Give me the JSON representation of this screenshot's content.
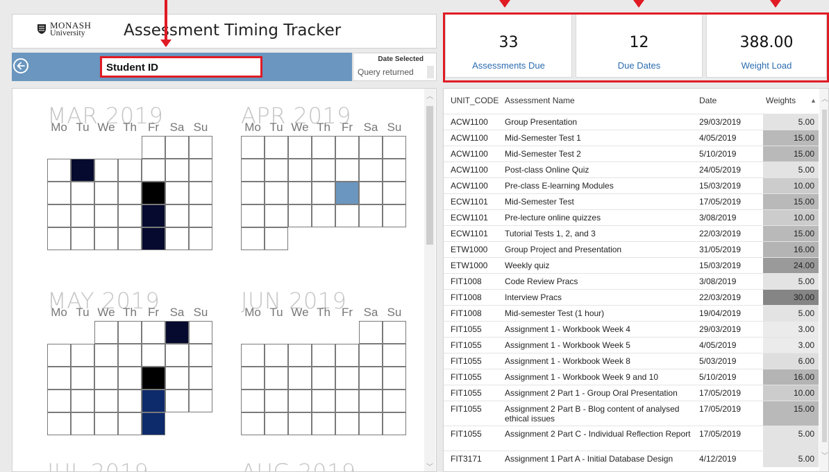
{
  "header": {
    "logo_line1": "MONASH",
    "logo_line2": "University",
    "title": "Assessment Timing Tracker"
  },
  "filter_bar": {
    "student_id_label": "Student ID",
    "date_selected_label": "Date Selected",
    "date_selected_value": "Query returned"
  },
  "kpis": [
    {
      "value": "33",
      "label": "Assessments Due"
    },
    {
      "value": "12",
      "label": "Due Dates"
    },
    {
      "value": "388.00",
      "label": "Weight Load"
    }
  ],
  "colors": {
    "accent_blue": "#6a96bf",
    "highlight_red": "#e01b24",
    "dark_navy": "#050a2e",
    "black": "#000000",
    "mid_blue": "#0d2a6b",
    "light_blue": "#6a96bf",
    "link_blue": "#2b6cb0"
  },
  "calendar": {
    "weekdays": [
      "Mo",
      "Tu",
      "We",
      "Th",
      "Fr",
      "Sa",
      "Su"
    ],
    "months": [
      {
        "title": "MAR 2019",
        "weeks": [
          [
            0,
            0,
            0,
            0,
            0,
            0,
            0
          ],
          [
            0,
            2,
            0,
            0,
            0,
            0,
            0
          ],
          [
            0,
            0,
            0,
            0,
            1,
            0,
            0
          ],
          [
            0,
            0,
            0,
            0,
            2,
            0,
            0
          ],
          [
            0,
            0,
            0,
            0,
            2,
            0,
            0
          ]
        ],
        "first_week_start": 4,
        "last_week_end": 6
      },
      {
        "title": "APR 2019",
        "weeks": [
          [
            0,
            0,
            0,
            0,
            0,
            0,
            0
          ],
          [
            0,
            0,
            0,
            0,
            0,
            0,
            0
          ],
          [
            0,
            0,
            0,
            0,
            4,
            0,
            0
          ],
          [
            0,
            0,
            0,
            0,
            0,
            0,
            0
          ],
          [
            0,
            0,
            0,
            0,
            0,
            0,
            0
          ]
        ],
        "first_week_start": 0,
        "last_week_end": 1
      },
      {
        "title": "MAY 2019",
        "weeks": [
          [
            0,
            0,
            0,
            0,
            0,
            2,
            0
          ],
          [
            0,
            0,
            0,
            0,
            0,
            0,
            0
          ],
          [
            0,
            0,
            0,
            0,
            1,
            0,
            0
          ],
          [
            0,
            0,
            0,
            0,
            3,
            0,
            0
          ],
          [
            0,
            0,
            0,
            0,
            3,
            0,
            0
          ]
        ],
        "first_week_start": 2,
        "last_week_end": 4
      },
      {
        "title": "JUN 2019",
        "weeks": [
          [
            0,
            0,
            0,
            0,
            0,
            0,
            0
          ],
          [
            0,
            0,
            0,
            0,
            0,
            0,
            0
          ],
          [
            0,
            0,
            0,
            0,
            0,
            0,
            0
          ],
          [
            0,
            0,
            0,
            0,
            0,
            0,
            0
          ],
          [
            0,
            0,
            0,
            0,
            0,
            0,
            0
          ]
        ],
        "first_week_start": 5,
        "last_week_end": 6
      }
    ],
    "partial_titles": [
      "JUL 2019",
      "AUG 2019"
    ]
  },
  "table": {
    "columns": [
      "UNIT_CODE",
      "Assessment Name",
      "Date",
      "Weights"
    ],
    "rows": [
      {
        "code": "ACW1100",
        "name": "Group Presentation",
        "date": "29/03/2019",
        "weight": "5.00",
        "shade": "#e3e3e3"
      },
      {
        "code": "ACW1100",
        "name": "Mid-Semester Test 1",
        "date": "4/05/2019",
        "weight": "15.00",
        "shade": "#b9b9b9"
      },
      {
        "code": "ACW1100",
        "name": "Mid-Semester Test 2",
        "date": "5/10/2019",
        "weight": "15.00",
        "shade": "#b9b9b9"
      },
      {
        "code": "ACW1100",
        "name": "Post-class Online Quiz",
        "date": "24/05/2019",
        "weight": "5.00",
        "shade": "#e3e3e3"
      },
      {
        "code": "ACW1100",
        "name": "Pre-class E-learning Modules",
        "date": "15/03/2019",
        "weight": "10.00",
        "shade": "#cccccc"
      },
      {
        "code": "ECW1101",
        "name": "Mid-Semester Test",
        "date": "17/05/2019",
        "weight": "15.00",
        "shade": "#b9b9b9"
      },
      {
        "code": "ECW1101",
        "name": "Pre-lecture online quizzes",
        "date": "3/08/2019",
        "weight": "10.00",
        "shade": "#cccccc"
      },
      {
        "code": "ECW1101",
        "name": "Tutorial Tests 1, 2, and 3",
        "date": "22/03/2019",
        "weight": "15.00",
        "shade": "#b9b9b9"
      },
      {
        "code": "ETW1000",
        "name": "Group Project and Presentation",
        "date": "31/05/2019",
        "weight": "16.00",
        "shade": "#b4b4b4"
      },
      {
        "code": "ETW1000",
        "name": "Weekly quiz",
        "date": "15/03/2019",
        "weight": "24.00",
        "shade": "#9a9a9a"
      },
      {
        "code": "FIT1008",
        "name": "Code Review Pracs",
        "date": "3/08/2019",
        "weight": "5.00",
        "shade": "#e3e3e3"
      },
      {
        "code": "FIT1008",
        "name": "Interview Pracs",
        "date": "22/03/2019",
        "weight": "30.00",
        "shade": "#858585"
      },
      {
        "code": "FIT1008",
        "name": "Mid-semester Test (1 hour)",
        "date": "19/04/2019",
        "weight": "5.00",
        "shade": "#e3e3e3"
      },
      {
        "code": "FIT1055",
        "name": "Assignment 1 - Workbook Week 4",
        "date": "29/03/2019",
        "weight": "3.00",
        "shade": "#ebebeb"
      },
      {
        "code": "FIT1055",
        "name": "Assignment 1 - Workbook Week 5",
        "date": "4/05/2019",
        "weight": "3.00",
        "shade": "#ebebeb"
      },
      {
        "code": "FIT1055",
        "name": "Assignment 1 - Workbook Week 8",
        "date": "5/03/2019",
        "weight": "6.00",
        "shade": "#dedede"
      },
      {
        "code": "FIT1055",
        "name": "Assignment 1 - Workbook Week 9 and 10",
        "date": "5/10/2019",
        "weight": "16.00",
        "shade": "#b4b4b4"
      },
      {
        "code": "FIT1055",
        "name": "Assignment 2 Part 1 - Group Oral Presentation",
        "date": "17/05/2019",
        "weight": "10.00",
        "shade": "#cccccc"
      },
      {
        "code": "FIT1055",
        "name": "Assignment 2 Part B - Blog content of analysed ethical issues",
        "date": "17/05/2019",
        "weight": "15.00",
        "shade": "#b9b9b9",
        "tall": true
      },
      {
        "code": "FIT1055",
        "name": "Assignment 2 Part C - Individual Reflection Report",
        "date": "17/05/2019",
        "weight": "5.00",
        "shade": "#e3e3e3",
        "tall": true
      },
      {
        "code": "FIT3171",
        "name": "Assignment 1 Part A - Initial Database Design",
        "date": "4/12/2019",
        "weight": "5.00",
        "shade": "#e3e3e3"
      }
    ]
  }
}
